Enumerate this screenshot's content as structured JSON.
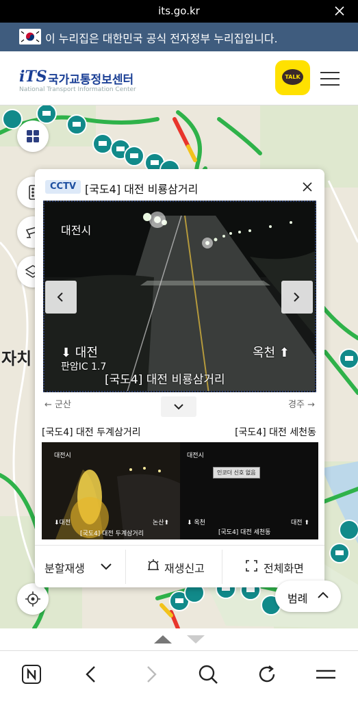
{
  "browser": {
    "url": "its.go.kr"
  },
  "gov_banner": {
    "text": "이 누리집은 대한민국 공식 전자정부 누리집입니다."
  },
  "header": {
    "logo_mark": "iTS",
    "logo_korean": "국가교통정보센터",
    "logo_english": "National Transport Information Center",
    "kakao_label": "TALK"
  },
  "map": {
    "place_label": "자치"
  },
  "cctv": {
    "badge": "CCTV",
    "title": "[국도4] 대전 비룡삼거리",
    "video": {
      "overlay_city": "대전시",
      "overlay_left": "⬇ 대전",
      "overlay_ic": "판암IC 1.7",
      "overlay_right": "옥천 ⬆",
      "overlay_caption": "[국도4]  대전 비룡삼거리"
    },
    "prev_direction": "← 군산",
    "next_direction": "경주 →",
    "nearby": [
      {
        "name": "[국도4] 대전 두계삼거리",
        "overlay_city": "대전시",
        "overlay_left": "⬇대전",
        "overlay_right": "논산⬆",
        "overlay_caption": "[국도4]  대전  두계삼거리"
      },
      {
        "name": "[국도4] 대전 세천동",
        "overlay_city": "대전시",
        "overlay_status": "인코더 신호 없음",
        "overlay_left": "⬇  옥천",
        "overlay_right": "대전 ⬆",
        "overlay_caption": "[국도4]  대전  세천동"
      }
    ],
    "actions": {
      "split": "분할재생",
      "report": "재생신고",
      "fullscreen": "전체화면"
    }
  },
  "legend": {
    "label": "범례"
  },
  "colors": {
    "banner": "#3f5c7e",
    "brand_blue": "#1a3f95",
    "kakao_yellow": "#ffe100",
    "road_green": "#2fb24a",
    "cctv_teal": "#118a8a"
  },
  "icons": [
    "close-icon",
    "grid-icon",
    "traffic-light-icon",
    "cctv-camera-icon",
    "layers-icon",
    "locate-icon",
    "chevron-down-icon",
    "alarm-icon",
    "fullscreen-icon",
    "naver-n-icon",
    "back-icon",
    "forward-icon",
    "search-icon",
    "refresh-icon",
    "menu-icon"
  ]
}
